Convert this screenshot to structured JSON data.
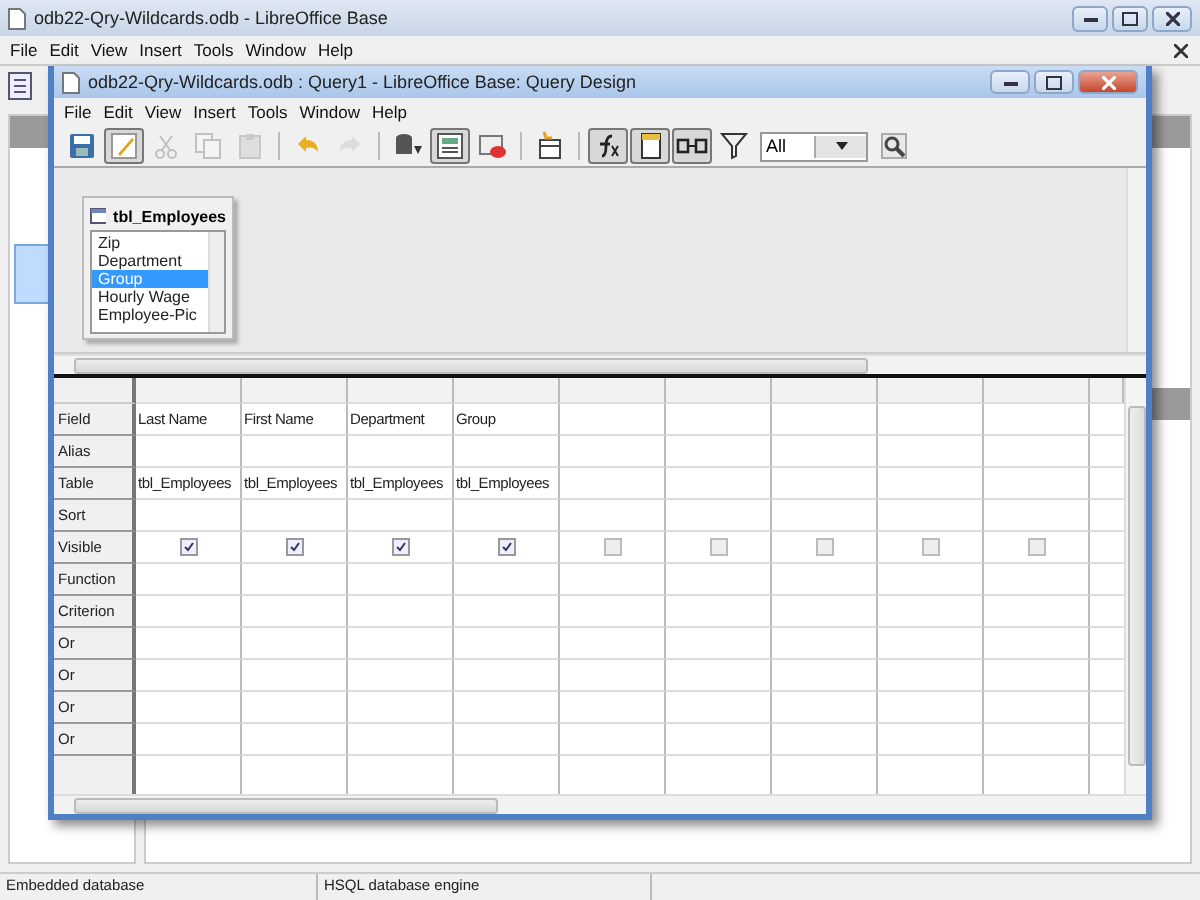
{
  "main_window": {
    "title": "odb22-Qry-Wildcards.odb - LibreOffice Base",
    "menu": [
      "File",
      "Edit",
      "View",
      "Insert",
      "Tools",
      "Window",
      "Help"
    ],
    "status_bar": [
      "Embedded database",
      "HSQL database engine"
    ]
  },
  "query_window": {
    "title": "odb22-Qry-Wildcards.odb : Query1 - LibreOffice Base: Query Design",
    "menu": [
      "File",
      "Edit",
      "View",
      "Insert",
      "Tools",
      "Window",
      "Help"
    ],
    "toolbar": [
      {
        "kind": "save",
        "pressed": false,
        "disabled": false
      },
      {
        "kind": "edit",
        "pressed": true,
        "disabled": false
      },
      {
        "kind": "cut",
        "pressed": false,
        "disabled": true
      },
      {
        "kind": "copy",
        "pressed": false,
        "disabled": true
      },
      {
        "kind": "paste",
        "pressed": false,
        "disabled": true
      },
      {
        "kind": "separator"
      },
      {
        "kind": "undo",
        "pressed": false,
        "disabled": false
      },
      {
        "kind": "redo",
        "pressed": false,
        "disabled": true
      },
      {
        "kind": "separator"
      },
      {
        "kind": "run",
        "pressed": false,
        "disabled": false
      },
      {
        "kind": "design",
        "pressed": true,
        "disabled": false
      },
      {
        "kind": "clear",
        "pressed": false,
        "disabled": false
      },
      {
        "kind": "separator"
      },
      {
        "kind": "add_table",
        "pressed": false,
        "disabled": false
      },
      {
        "kind": "separator"
      },
      {
        "kind": "functions",
        "pressed": true,
        "disabled": false
      },
      {
        "kind": "table_name",
        "pressed": true,
        "disabled": false
      },
      {
        "kind": "alias",
        "pressed": true,
        "disabled": false
      },
      {
        "kind": "distinct",
        "pressed": false,
        "disabled": false
      },
      {
        "kind": "limit",
        "value": "All"
      },
      {
        "kind": "zoom",
        "pressed": false,
        "disabled": false
      }
    ],
    "table_window": {
      "title": "tbl_Employees",
      "fields": [
        {
          "label": "Zip",
          "selected": false
        },
        {
          "label": "Department",
          "selected": false
        },
        {
          "label": "Group",
          "selected": true
        },
        {
          "label": "Hourly Wage",
          "selected": false
        },
        {
          "label": "Employee-Pic",
          "selected": false
        }
      ]
    },
    "grid": {
      "rows": [
        {
          "label": "Field",
          "kind": "field"
        },
        {
          "label": "Alias",
          "kind": "alias"
        },
        {
          "label": "Table",
          "kind": "table"
        },
        {
          "label": "Sort",
          "kind": "sort"
        },
        {
          "label": "Visible",
          "kind": "visible"
        },
        {
          "label": "Function",
          "kind": "function"
        },
        {
          "label": "Criterion",
          "kind": "criterion"
        },
        {
          "label": "Or",
          "kind": "or"
        },
        {
          "label": "Or",
          "kind": "or"
        },
        {
          "label": "Or",
          "kind": "or"
        },
        {
          "label": "Or",
          "kind": "or"
        }
      ],
      "columns": [
        {
          "field": "Last Name",
          "table": "tbl_Employees",
          "visible": true
        },
        {
          "field": "First Name",
          "table": "tbl_Employees",
          "visible": true
        },
        {
          "field": "Department",
          "table": "tbl_Employees",
          "visible": true
        },
        {
          "field": "Group",
          "table": "tbl_Employees",
          "visible": true
        },
        {
          "visible": false
        },
        {
          "visible": false
        },
        {
          "visible": false
        },
        {
          "visible": false
        },
        {
          "visible": false
        }
      ]
    }
  }
}
